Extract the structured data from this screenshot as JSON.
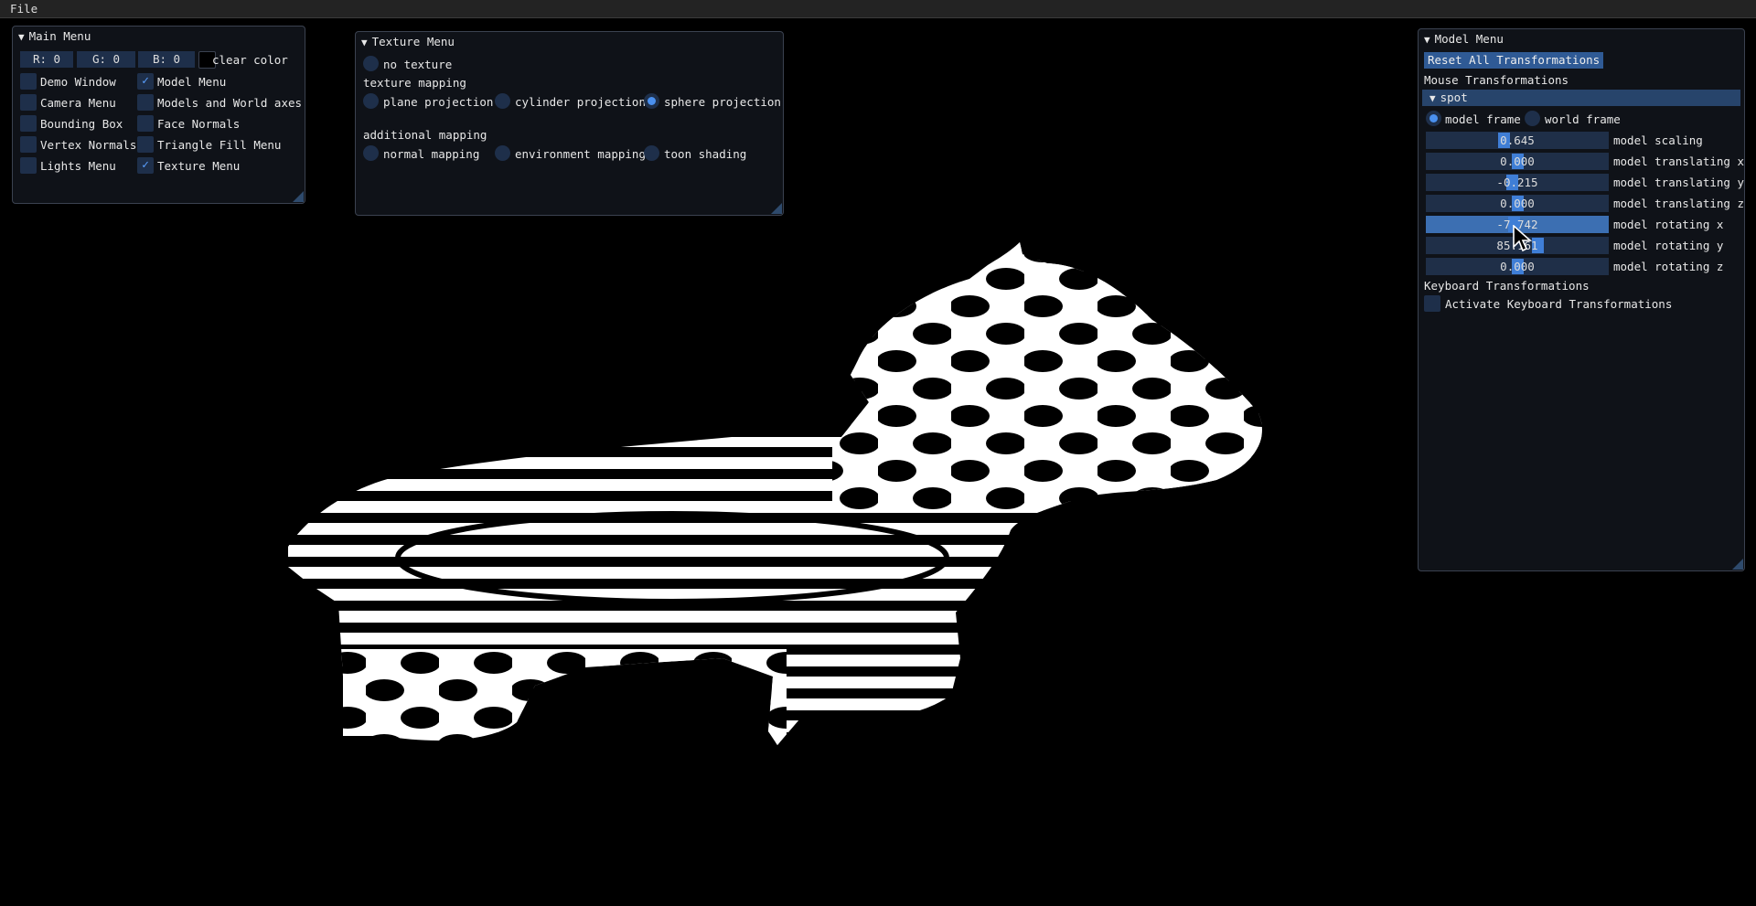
{
  "menubar": {
    "file": "File"
  },
  "main_menu": {
    "title": "Main Menu",
    "clear_color": {
      "r": "R:  0",
      "g": "G:  0",
      "b": "B:  0",
      "label": "clear color"
    },
    "checkboxes": {
      "demo_window": "Demo Window",
      "model_menu": "Model Menu",
      "camera_menu": "Camera Menu",
      "models_world_axes": "Models and World axes",
      "bounding_box": "Bounding Box",
      "face_normals": "Face Normals",
      "vertex_normals": "Vertex Normals",
      "triangle_fill_menu": "Triangle Fill Menu",
      "lights_menu": "Lights Menu",
      "texture_menu": "Texture Menu"
    }
  },
  "texture_menu": {
    "title": "Texture Menu",
    "no_texture": "no texture",
    "texture_mapping": "texture mapping",
    "plane_projection": "plane projection",
    "cylinder_projection": "cylinder projection",
    "sphere_projection": "sphere projection",
    "additional_mapping": "additional mapping",
    "normal_mapping": "normal mapping",
    "environment_mapping": "environment mapping",
    "toon_shading": "toon shading"
  },
  "model_menu": {
    "title": "Model Menu",
    "reset_button": "Reset All Transformations",
    "mouse_transformations": "Mouse Transformations",
    "model_name": "spot",
    "model_frame": "model frame",
    "world_frame": "world frame",
    "sliders": [
      {
        "value": "0.645",
        "label": "model scaling",
        "fraction": 0.42
      },
      {
        "value": "0.000",
        "label": "model translating x",
        "fraction": 0.5
      },
      {
        "value": "-0.215",
        "label": "model translating y",
        "fraction": 0.47
      },
      {
        "value": "0.000",
        "label": "model translating z",
        "fraction": 0.5
      },
      {
        "value": "-7.742",
        "label": "model rotating x",
        "fraction": 0.48
      },
      {
        "value": "85.161",
        "label": "model rotating y",
        "fraction": 0.62
      },
      {
        "value": "0.000",
        "label": "model rotating z",
        "fraction": 0.5
      }
    ],
    "keyboard_transformations": "Keyboard Transformations",
    "activate_keyboard": "Activate Keyboard Transformations"
  },
  "colors": {
    "accent": "#4a90ef",
    "frame_bg": "#1e2f4a",
    "window_bg": "#10131a"
  },
  "icons": [
    "collapse-triangle-icon",
    "checkmark-icon",
    "resize-grip-icon",
    "mouse-pointer-icon"
  ]
}
